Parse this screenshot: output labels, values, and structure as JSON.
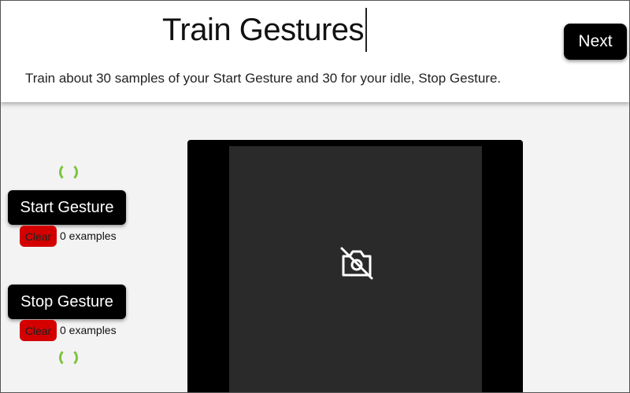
{
  "header": {
    "title": "Train Gestures",
    "subtitle": "Train about 30 samples of your Start Gesture and 30 for your idle, Stop Gesture.",
    "next_label": "Next"
  },
  "gestures": [
    {
      "label": "Start Gesture",
      "clear_label": "Clear",
      "count_text": "0 examples"
    },
    {
      "label": "Stop Gesture",
      "clear_label": "Clear",
      "count_text": "0 examples"
    }
  ],
  "video": {
    "icon": "no-camera-icon"
  },
  "colors": {
    "header_bg": "#ffffff",
    "page_bg": "#f3f3f3",
    "button_bg": "#000000",
    "clear_bg": "#d40000",
    "spinner": "#7cc43d",
    "video_bg": "#000000",
    "video_inner": "#2a2a2a"
  }
}
